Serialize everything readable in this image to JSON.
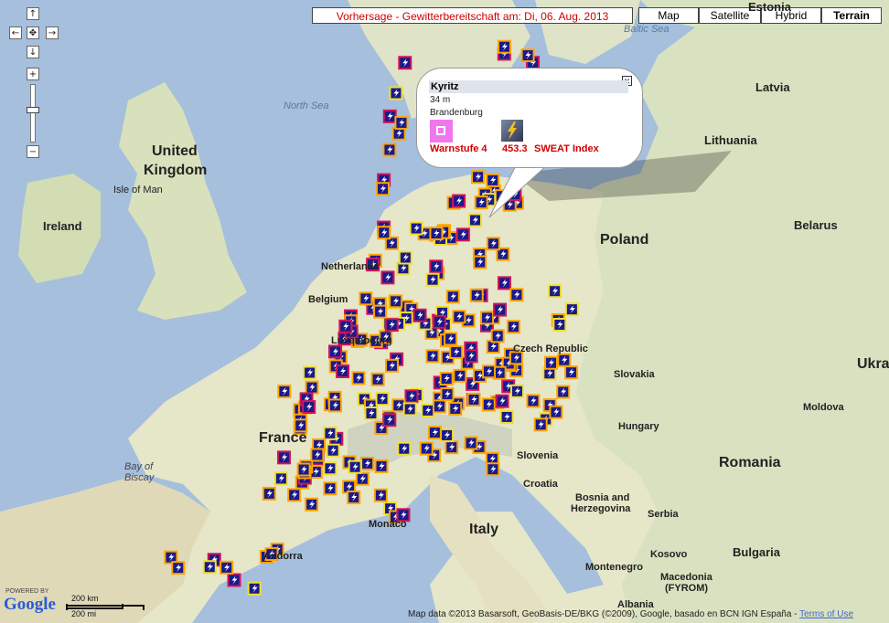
{
  "header": {
    "forecast_title": "Vorhersage - Gewitterbereitschaft am: Di, 06. Aug. 2013"
  },
  "map_types": [
    {
      "label": "Map",
      "active": false
    },
    {
      "label": "Satellite",
      "active": false
    },
    {
      "label": "Hybrid",
      "active": false
    },
    {
      "label": "Terrain",
      "active": true
    }
  ],
  "nav": {
    "up": "↑",
    "left": "←",
    "center": "✥",
    "right": "→",
    "down": "↓",
    "zoom_in": "+",
    "zoom_out": "−"
  },
  "popup": {
    "station": "Kyritz",
    "elevation": "34 m",
    "region": "Brandenburg",
    "warn_label": "Warnstufe 4",
    "sweat_value": "453.3",
    "sweat_label": "SWEAT Index",
    "close": "✕"
  },
  "places": {
    "united_kingdom_1": "United",
    "united_kingdom_2": "Kingdom",
    "isle_of_man": "Isle of Man",
    "ireland": "Ireland",
    "north_sea": "North Sea",
    "baltic_sea": "Baltic Sea",
    "estonia": "Estonia",
    "latvia": "Latvia",
    "lithuania": "Lithuania",
    "belarus": "Belarus",
    "poland": "Poland",
    "netherlands": "Netherlands",
    "belgium": "Belgium",
    "luxembourg": "Luxembourg",
    "czech": "Czech Republic",
    "slovakia": "Slovakia",
    "ukraine": "Ukra",
    "moldova": "Moldova",
    "hungary": "Hungary",
    "romania": "Romania",
    "france": "France",
    "bay_biscay_1": "Bay of",
    "bay_biscay_2": "Biscay",
    "slovenia": "Slovenia",
    "croatia": "Croatia",
    "bosnia_1": "Bosnia and",
    "bosnia_2": "Herzegovina",
    "serbia": "Serbia",
    "monaco": "Monaco",
    "italy": "Italy",
    "andorra": "Andorra",
    "kosovo": "Kosovo",
    "bulgaria": "Bulgaria",
    "montenegro": "Montenegro",
    "macedonia_1": "Macedonia",
    "macedonia_2": "(FYROM)",
    "albania": "Albania"
  },
  "footer": {
    "attribution": "Map data ©2013 Basarsoft, GeoBasis-DE/BKG (©2009), Google, basado en BCN IGN España - ",
    "terms": "Terms of Use"
  },
  "scale": {
    "km": "200 km",
    "mi": "200 mi"
  },
  "logo": {
    "powered": "POWERED BY",
    "google": "Google"
  },
  "colors": {
    "land": "#efeadd",
    "sea": "#a5bfdd",
    "forest": "#cbd9b0",
    "warn_level_2": "#ffa500",
    "warn_level_3": "#d4145a",
    "warn_level_1": "#f2e02a",
    "marker_bg": "#1a1a8a"
  },
  "icons": [
    "lightning-marker-icon",
    "close-icon",
    "pan-arrow-icon",
    "zoom-slider-icon"
  ]
}
